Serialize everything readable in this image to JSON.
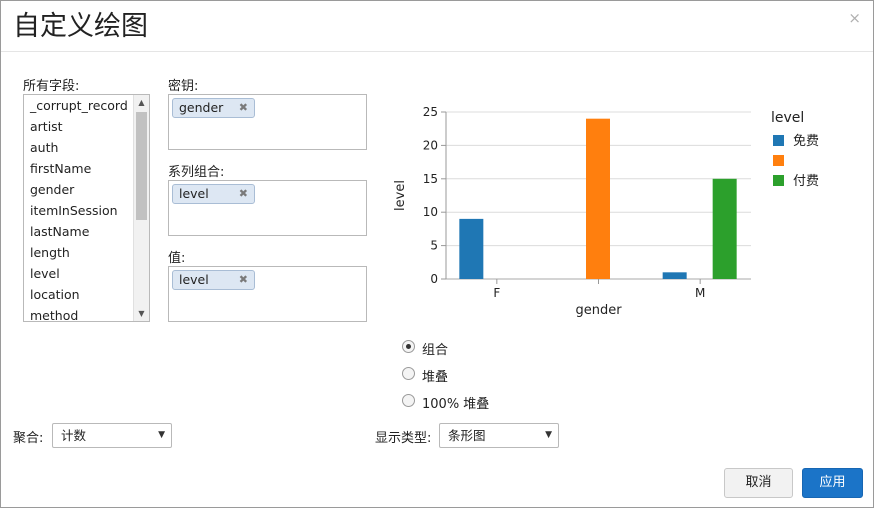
{
  "dialog": {
    "title": "自定义绘图",
    "close_glyph": "×"
  },
  "fields": {
    "label": "所有字段:",
    "items": [
      "_corrupt_record",
      "artist",
      "auth",
      "firstName",
      "gender",
      "itemInSession",
      "lastName",
      "length",
      "level",
      "location",
      "method"
    ]
  },
  "keys": {
    "label": "密钥:",
    "tag": "gender"
  },
  "series": {
    "label": "系列组合:",
    "tag": "level"
  },
  "values": {
    "label": "值:",
    "tag": "level"
  },
  "tag_remove_glyph": "✖",
  "chart_data": {
    "type": "bar",
    "categories": [
      "F",
      "",
      "M"
    ],
    "series": [
      {
        "name": "免费",
        "color": "#1f77b4",
        "values": [
          9,
          0,
          1
        ]
      },
      {
        "name": "",
        "color": "#ff7f0e",
        "values": [
          0,
          24,
          0
        ]
      },
      {
        "name": "付费",
        "color": "#2ca02c",
        "values": [
          0,
          0,
          15
        ]
      }
    ],
    "xlabel": "gender",
    "ylabel": "level",
    "ylim": [
      0,
      25
    ],
    "yticks": [
      0,
      5,
      10,
      15,
      20,
      25
    ],
    "legend_title": "level",
    "legend_position": "right",
    "grid": true
  },
  "display_mode": {
    "options": [
      "组合",
      "堆叠",
      "100% 堆叠"
    ],
    "selected_index": 0
  },
  "aggregation": {
    "label": "聚合:",
    "value": "计数"
  },
  "display_type": {
    "label": "显示类型:",
    "value": "条形图"
  },
  "buttons": {
    "cancel": "取消",
    "apply": "应用"
  }
}
